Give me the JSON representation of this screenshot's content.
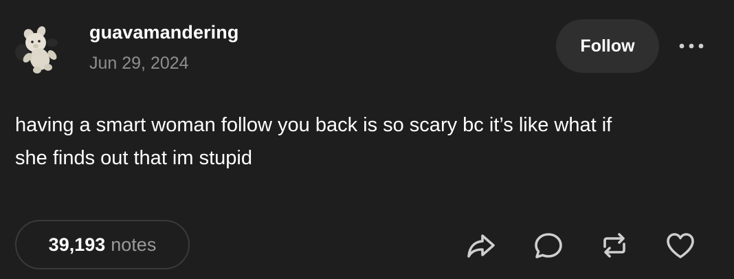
{
  "post": {
    "author": "guavamandering",
    "date": "Jun 29, 2024",
    "follow_label": "Follow",
    "body_lines": [
      "having a smart woman follow you back is so scary bc it’s like what if",
      "she finds out that im stupid"
    ],
    "notes_count": "39,193",
    "notes_label": "notes"
  },
  "icons": {
    "avatar": "teddy-bear-avatar-icon",
    "more": "ellipsis-icon",
    "share": "share-icon",
    "reply": "reply-icon",
    "reblog": "reblog-icon",
    "like": "heart-icon"
  },
  "colors": {
    "background": "#1e1e1e",
    "text": "#ffffff",
    "muted": "#8e8e8e",
    "button": "#2f2f2f",
    "icon": "#cfcfcf"
  }
}
